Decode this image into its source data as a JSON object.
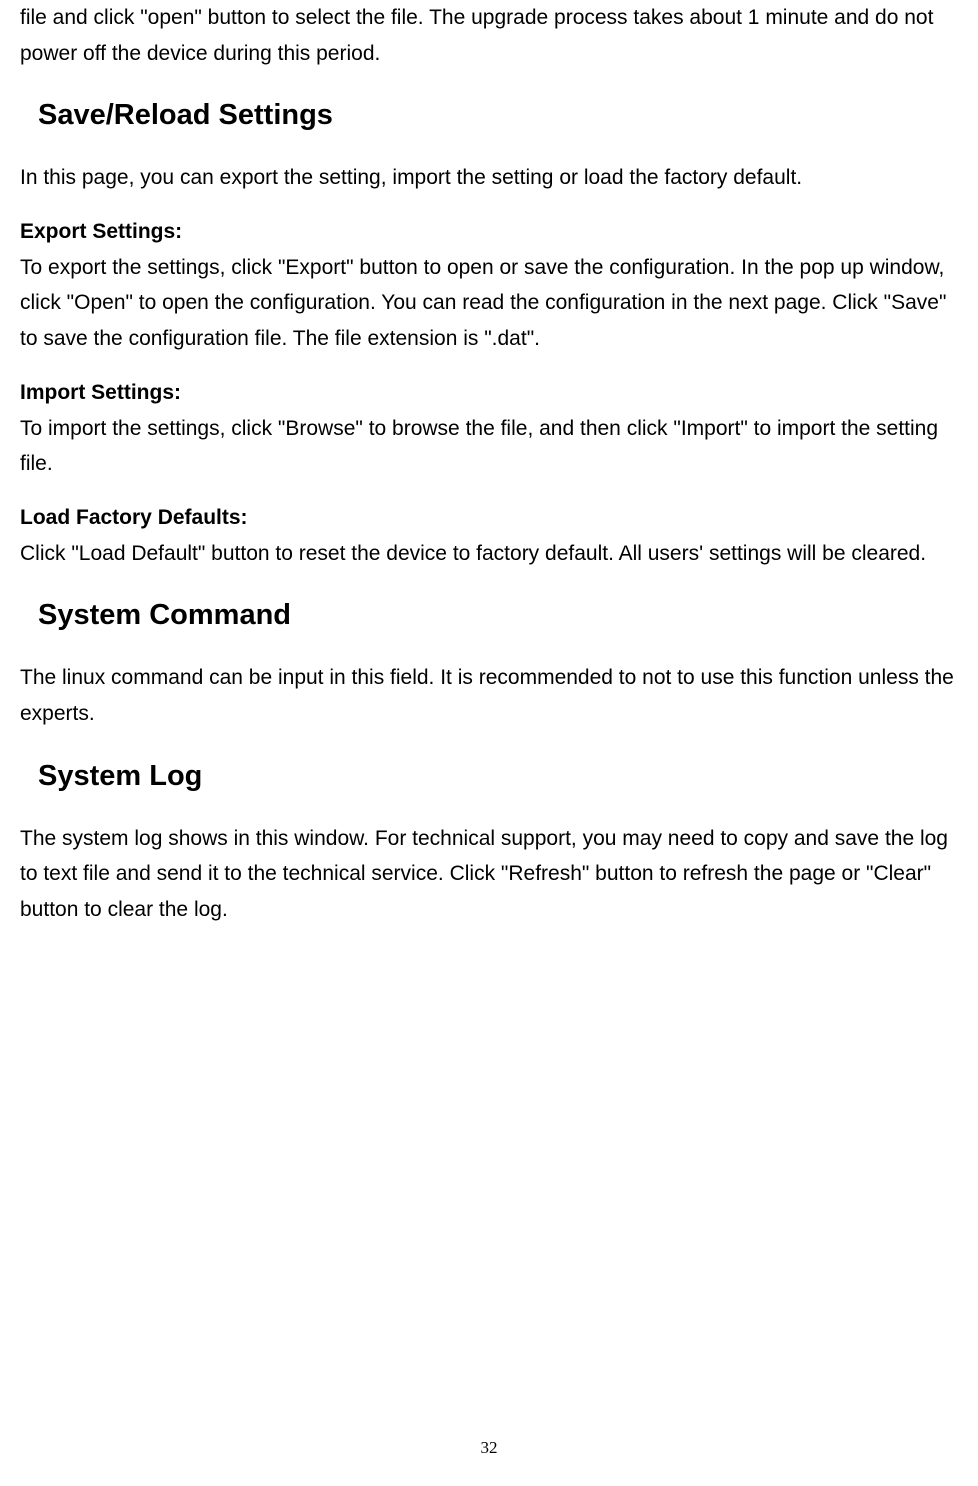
{
  "intro": "file and click \"open\" button to select the file. The upgrade process takes about 1 minute and do not power off the device during this period.",
  "sections": {
    "saveReload": {
      "heading": "Save/Reload Settings",
      "intro": "In this page, you can export the setting, import the setting or load the factory default.",
      "exportHeading": "Export Settings:",
      "exportBody": "To export the settings, click \"Export\" button to open or save the configuration. In the pop up window, click \"Open\" to open the configuration. You can read the configuration in the next page. Click \"Save\" to save the configuration file. The file extension is \".dat\".",
      "importHeading": "Import Settings:",
      "importBody": "To import the settings, click \"Browse\" to browse the file, and then click \"Import\" to import the setting file.",
      "loadDefaultHeading": "Load Factory Defaults:",
      "loadDefaultBody": "Click \"Load Default\" button to reset the device to factory default. All users' settings will be cleared."
    },
    "systemCommand": {
      "heading": "System Command",
      "body": "The linux command can be input in this field. It is recommended to not to use this function unless the experts."
    },
    "systemLog": {
      "heading": "System Log",
      "body": "The system log shows in this window. For technical support, you may need to copy and save the log to text file and send it to the technical service. Click \"Refresh\" button to refresh the page or \"Clear\" button to clear the log."
    }
  },
  "pageNumber": "32"
}
